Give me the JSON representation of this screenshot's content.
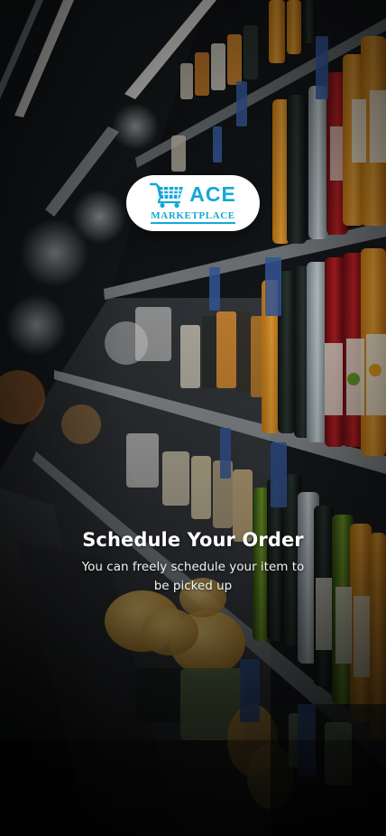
{
  "background": {
    "description_icon": "supermarket-shelves-photo"
  },
  "logo": {
    "brand": "ACE",
    "tagline": "MARKETPLACE",
    "icon": "shopping-cart-icon",
    "color": "#13a8d6"
  },
  "onboarding": {
    "title": "Schedule Your Order",
    "subtitle": "You can freely schedule your item to be picked up"
  }
}
